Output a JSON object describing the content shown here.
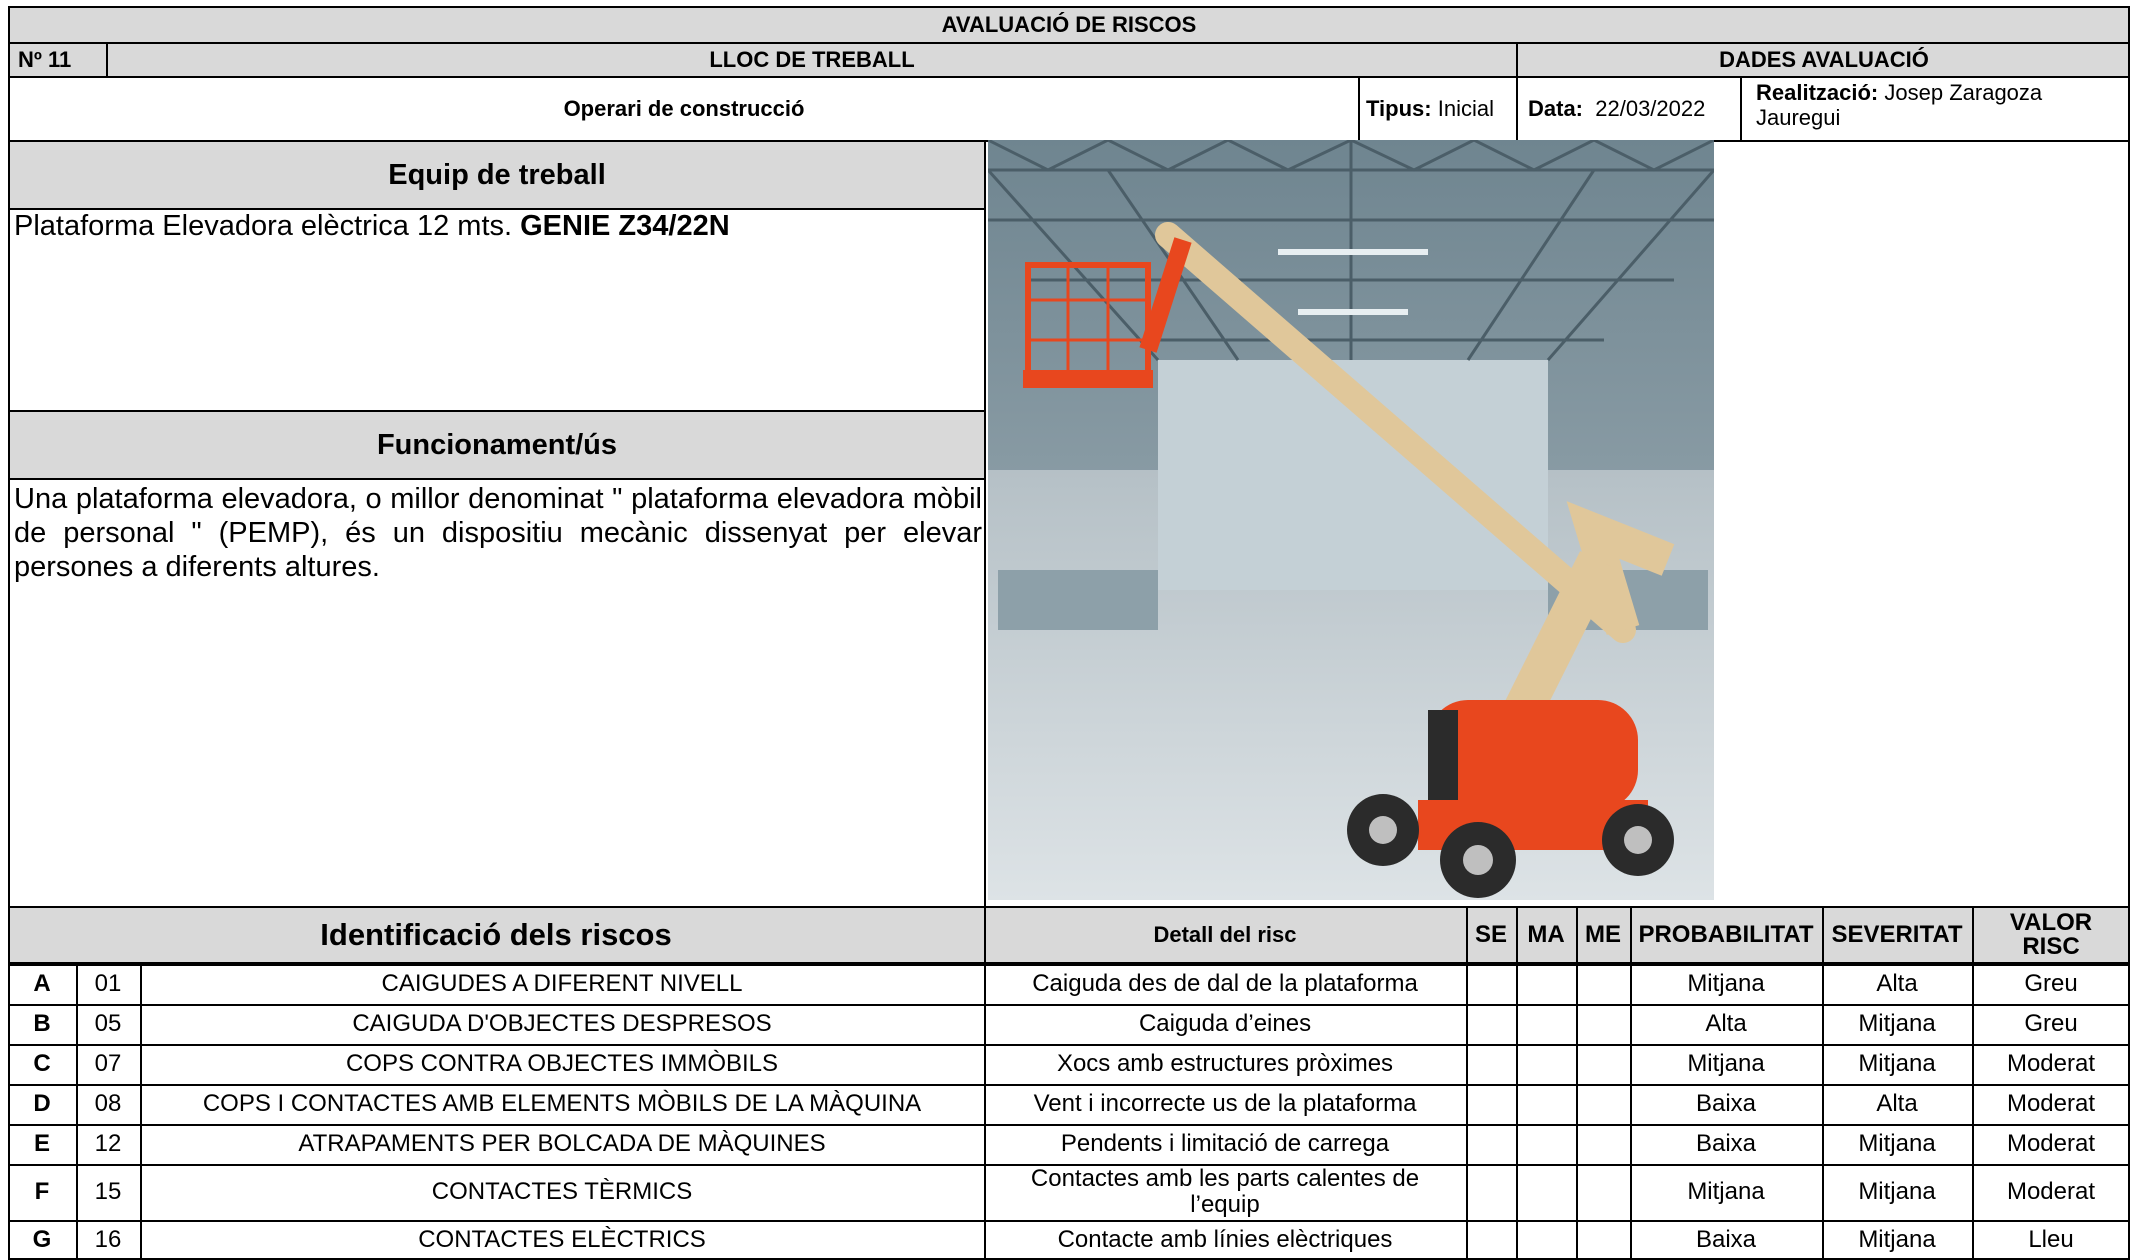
{
  "header": {
    "title": "AVALUACIÓ DE RISCOS",
    "number": "Nº 11",
    "job_label": "LLOC DE TREBALL",
    "eval_label": "DADES AVALUACIÓ",
    "job": "Operari de construcció",
    "tipus_label": "Tipus:",
    "tipus_value": "Inicial",
    "data_label": "Data:",
    "data_value": "22/03/2022",
    "realitzacio_label": "Realització:",
    "realitzacio_value": "Josep Zaragoza Jauregui"
  },
  "equip": {
    "heading": "Equip de treball",
    "description": "Plataforma Elevadora elèctrica 12 mts.",
    "model": "GENIE Z34/22N"
  },
  "funcionament": {
    "heading": "Funcionament/ús",
    "text": "Una plataforma elevadora, o millor denominat \" plataforma elevadora mòbil de personal \" (PEMP), és un dispositiu mecànic dissenyat per elevar persones a diferents altures."
  },
  "photo": {
    "alt": "Plataforma elevadora articulada en una nau industrial",
    "colors": {
      "boom": "#e0c79a",
      "orange": "#e8471e",
      "hall": "#c9d3d8"
    }
  },
  "risks": {
    "headers": {
      "identificacio": "Identificació dels riscos",
      "detall": "Detall del risc",
      "se": "SE",
      "ma": "MA",
      "me": "ME",
      "probabilitat": "PROBABILITAT",
      "severitat": "SEVERITAT",
      "valor": "VALOR RISC"
    },
    "rows": [
      {
        "letter": "A",
        "code": "01",
        "name": "CAIGUDES A DIFERENT NIVELL",
        "detail": "Caiguda des de dal de la plataforma",
        "se": "",
        "ma": "",
        "me": "",
        "probability": "Mitjana",
        "severity": "Alta",
        "value": "Greu"
      },
      {
        "letter": "B",
        "code": "05",
        "name": "CAIGUDA D'OBJECTES DESPRESOS",
        "detail": "Caiguda d’eines",
        "se": "",
        "ma": "",
        "me": "",
        "probability": "Alta",
        "severity": "Mitjana",
        "value": "Greu"
      },
      {
        "letter": "C",
        "code": "07",
        "name": "COPS CONTRA OBJECTES IMMÒBILS",
        "detail": "Xocs amb estructures pròximes",
        "se": "",
        "ma": "",
        "me": "",
        "probability": "Mitjana",
        "severity": "Mitjana",
        "value": "Moderat"
      },
      {
        "letter": "D",
        "code": "08",
        "name": "COPS I CONTACTES AMB ELEMENTS MÒBILS DE LA MÀQUINA",
        "detail": "Vent i incorrecte us de la plataforma",
        "se": "",
        "ma": "",
        "me": "",
        "probability": "Baixa",
        "severity": "Alta",
        "value": "Moderat"
      },
      {
        "letter": "E",
        "code": "12",
        "name": "ATRAPAMENTS PER BOLCADA DE MÀQUINES",
        "detail": "Pendents i limitació de carrega",
        "se": "",
        "ma": "",
        "me": "",
        "probability": "Baixa",
        "severity": "Mitjana",
        "value": "Moderat"
      },
      {
        "letter": "F",
        "code": "15",
        "name": "CONTACTES TÈRMICS",
        "detail": "Contactes amb les parts calentes de l’equip",
        "se": "",
        "ma": "",
        "me": "",
        "probability": "Mitjana",
        "severity": "Mitjana",
        "value": "Moderat"
      },
      {
        "letter": "G",
        "code": "16",
        "name": "CONTACTES ELÈCTRICS",
        "detail": "Contacte amb línies elèctriques",
        "se": "",
        "ma": "",
        "me": "",
        "probability": "Baixa",
        "severity": "Mitjana",
        "value": "Lleu"
      }
    ]
  }
}
